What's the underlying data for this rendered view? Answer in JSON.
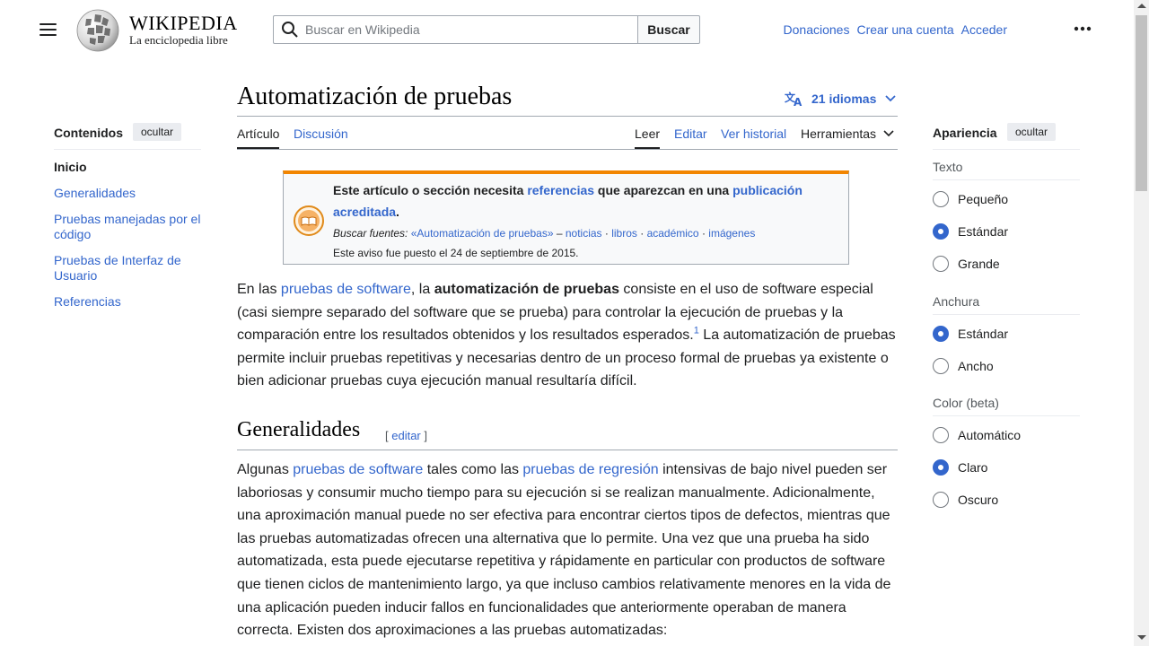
{
  "header": {
    "wordmark": "WIKIPEDIA",
    "tagline": "La enciclopedia libre",
    "search_placeholder": "Buscar en Wikipedia",
    "search_button": "Buscar",
    "links": [
      "Donaciones",
      "Crear una cuenta",
      "Acceder"
    ],
    "icons": [
      "menu-icon",
      "wikipedia-globe-logo",
      "search-icon",
      "more-options-icon"
    ]
  },
  "toc": {
    "title": "Contenidos",
    "hide": "ocultar",
    "items": [
      "Inicio",
      "Generalidades",
      "Pruebas manejadas por el código",
      "Pruebas de Interfaz de Usuario",
      "Referencias"
    ]
  },
  "article": {
    "title": "Automatización de pruebas",
    "languages": "21 idiomas",
    "tabs": {
      "article": "Artículo",
      "talk": "Discusión",
      "read": "Leer",
      "edit": "Editar",
      "history": "Ver historial",
      "tools": "Herramientas"
    },
    "ambox": {
      "t1": "Este artículo o sección necesita ",
      "link1": "referencias",
      "t2": " que aparezcan en una ",
      "link2": "publicación acreditada",
      "t3": ".",
      "sources_label": "Buscar fuentes:",
      "sources_query": "«Automatización de pruebas»",
      "sources_dash": " – ",
      "sources_links": [
        "noticias",
        "libros",
        "académico",
        "imágenes"
      ],
      "date_text": "Este aviso fue puesto el 24 de septiembre de 2015."
    },
    "p1": {
      "t1": "En las ",
      "link1": "pruebas de software",
      "t2": ", la ",
      "bold": "automatización de pruebas",
      "t3": " consiste en el uso de software especial (casi siempre separado del software que se prueba) para controlar la ejecución de pruebas y la comparación entre los resultados obtenidos y los resultados esperados.",
      "ref": "1",
      "t4": " La automatización de pruebas permite incluir pruebas repetitivas y necesarias dentro de un proceso formal de pruebas ya existente o bien adicionar pruebas cuya ejecución manual resultaría difícil."
    },
    "section": {
      "heading": "Generalidades",
      "edit_open": "[ ",
      "edit": "editar",
      "edit_close": " ]"
    },
    "p2": {
      "t1": "Algunas ",
      "link1": "pruebas de software",
      "t2": " tales como las ",
      "link2": "pruebas de regresión",
      "t3": " intensivas de bajo nivel pueden ser laboriosas y consumir mucho tiempo para su ejecución si se realizan manualmente. Adicionalmente, una aproximación manual puede no ser efectiva para encontrar ciertos tipos de defectos, mientras que las pruebas automatizadas ofrecen una alternativa que lo permite. Una vez que una prueba ha sido automatizada, esta puede ejecutarse repetitiva y rápidamente en particular con productos de software que tienen ciclos de mantenimiento largo, ya que incluso cambios relativamente menores en la vida de una aplicación pueden inducir fallos en funcionalidades que anteriormente operaban de manera correcta. Existen dos aproximaciones a las pruebas automatizadas:"
    }
  },
  "appearance": {
    "title": "Apariencia",
    "hide": "ocultar",
    "text_label": "Texto",
    "text_options": [
      "Pequeño",
      "Estándar",
      "Grande"
    ],
    "text_selected": "Estándar",
    "width_label": "Anchura",
    "width_options": [
      "Estándar",
      "Ancho"
    ],
    "width_selected": "Estándar",
    "color_label": "Color (beta)",
    "color_options": [
      "Automático",
      "Claro",
      "Oscuro"
    ],
    "color_selected": "Claro"
  },
  "colors": {
    "link": "#3366cc",
    "notice_border": "#f28500",
    "text": "#202122"
  }
}
